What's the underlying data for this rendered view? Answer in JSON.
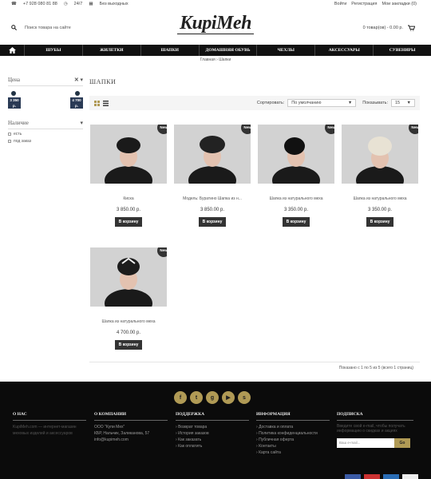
{
  "topbar": {
    "phone": "+7 928 080 81 88",
    "hours": "24/7",
    "days": "Без выходных",
    "login": "Войти",
    "register": "Регистрация",
    "bookmarks": "Мои закладки (0)"
  },
  "logo": "KupiMeh",
  "search": {
    "placeholder": "Поиск товара на сайте"
  },
  "cart": {
    "label": "0 товар(ов) - 0.00 р."
  },
  "nav": [
    "ШУБЫ",
    "ЖИЛЕТКИ",
    "ШАПКИ",
    "ДОМАШНЯЯ ОБУВЬ",
    "ЧЕХЛЫ",
    "АКСЕССУАРЫ",
    "СУВЕНИРЫ"
  ],
  "breadcrumb": {
    "home": "Главная",
    "current": "Шапки"
  },
  "sidebar": {
    "price_title": "Цена",
    "price_min": "3 350 р.",
    "price_max": "4 700 р.",
    "availability_title": "Наличие",
    "options": [
      "есть",
      "под заказ"
    ]
  },
  "page_title": "ШАПКИ",
  "toolbar": {
    "sort_label": "Сортировать:",
    "sort_value": "По умолчанию",
    "show_label": "Показывать:",
    "show_value": "15"
  },
  "products": [
    {
      "name": "Киска",
      "price": "3 850.00 р.",
      "badge": "New",
      "button": "В корзину"
    },
    {
      "name": "Модель: Буратино Шапка из н...",
      "price": "3 850.00 р.",
      "badge": "New",
      "button": "В корзину"
    },
    {
      "name": "Шапка из натурального меха",
      "price": "3 350.00 р.",
      "badge": "New",
      "button": "В корзину"
    },
    {
      "name": "Шапка из натурального меха",
      "price": "3 350.00 р.",
      "badge": "New",
      "button": "В корзину"
    },
    {
      "name": "Шапка из натурального меха",
      "price": "4 700.00 р.",
      "badge": "New",
      "button": "В корзину"
    }
  ],
  "pagination": "Показано с 1 по 5 из 5 (всего 1 страниц)",
  "footer": {
    "about": {
      "title": "О НАС",
      "text": "KupiMeh.com — интернет-магазин меховых изделий и аксессуаров"
    },
    "company": {
      "title": "О КОМПАНИИ",
      "lines": [
        "ООО \"Купи Мех\"",
        "КБР, Нальчик, Заликанова, 57",
        "info@kupimeh.com"
      ]
    },
    "support": {
      "title": "ПОДДЕРЖКА",
      "links": [
        "Возврат товара",
        "История заказов",
        "Как заказать",
        "Как оплатить"
      ]
    },
    "info": {
      "title": "ИНФОРМАЦИЯ",
      "links": [
        "Доставка и оплата",
        "Политика конфиденциальности",
        "Публичная оферта",
        "Контакты",
        "Карта сайта"
      ]
    },
    "subscribe": {
      "title": "ПОДПИСКА",
      "text": "Введите свой e-mail, чтобы получать информацию о скидках и акциях",
      "placeholder": "Ваш e-mail...",
      "button": "Go"
    }
  },
  "colors": {
    "accent": "#b09a55",
    "dark": "#111111",
    "button": "#333333"
  }
}
